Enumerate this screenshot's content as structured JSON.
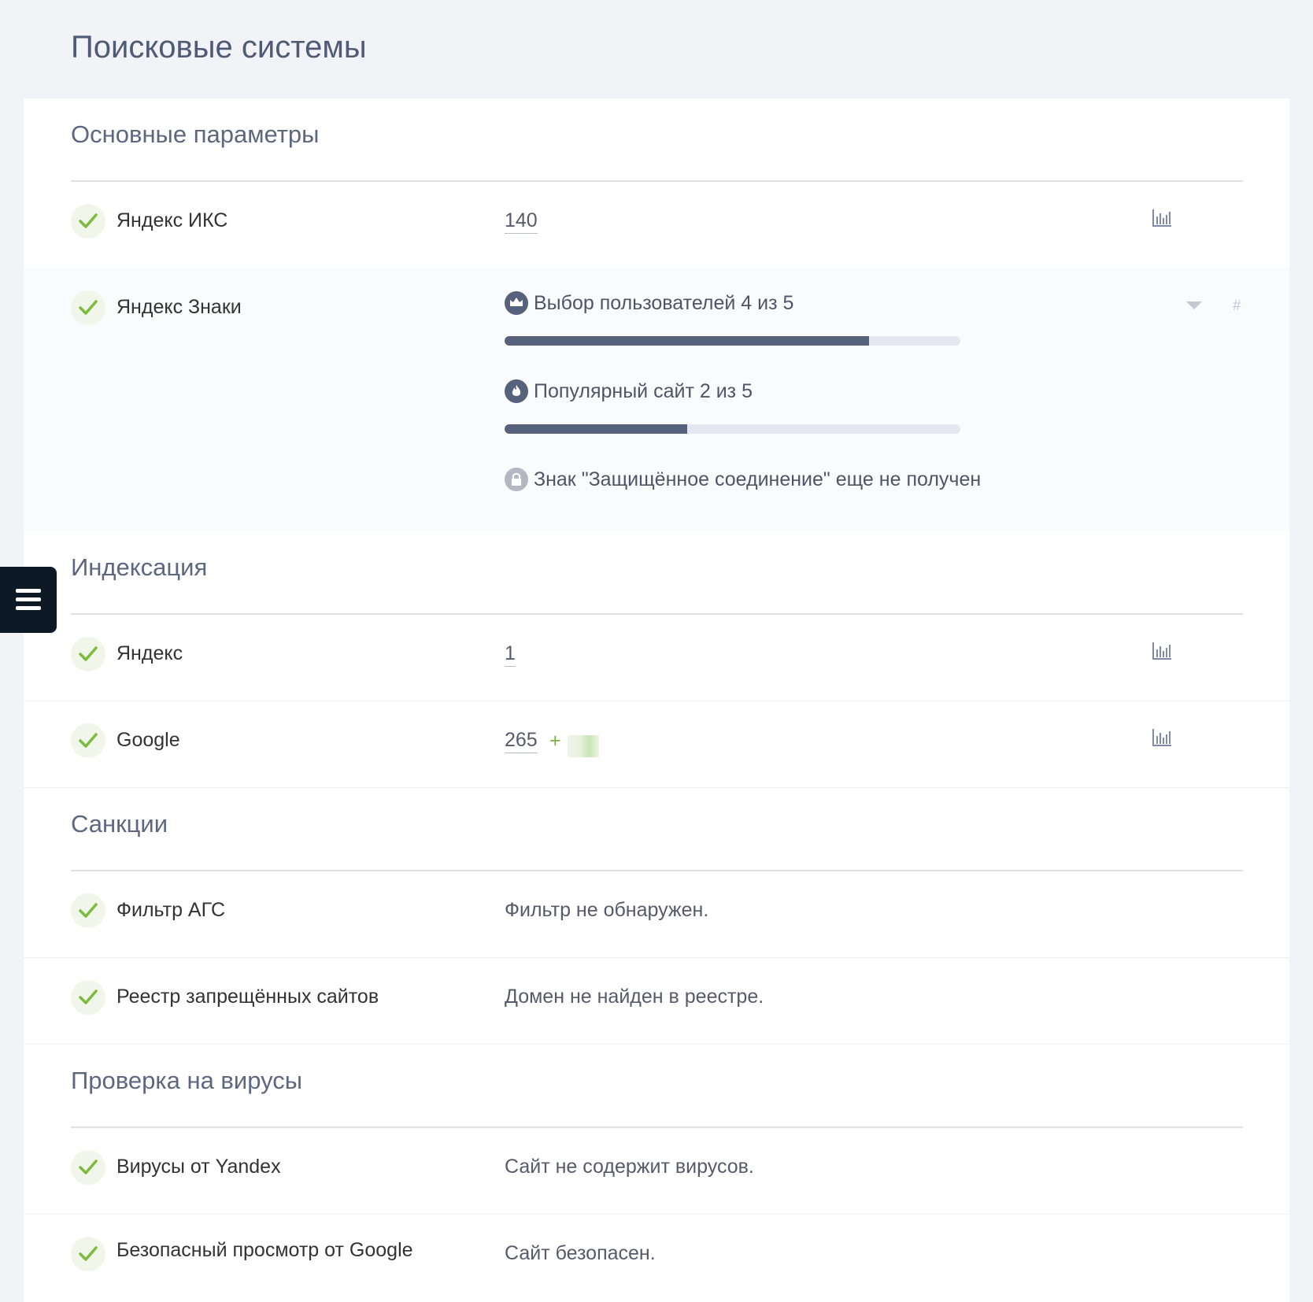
{
  "page_title": "Поисковые системы",
  "colors": {
    "accent": "#56627c",
    "check": "#7dbb3c",
    "menu_bg": "#0d1a26"
  },
  "sections": {
    "main": {
      "title": "Основные параметры",
      "iks": {
        "label": "Яндекс ИКС",
        "value": "140"
      },
      "znaki": {
        "label": "Яндекс Знаки",
        "badges": [
          {
            "icon": "crown-icon",
            "text": "Выбор пользователей 4 из 5",
            "progress": 0.8
          },
          {
            "icon": "fire-icon",
            "text": "Популярный сайт 2 из 5",
            "progress": 0.4
          },
          {
            "icon": "lock-icon",
            "text": "Знак \"Защищённое соединение\" еще не получен"
          }
        ],
        "hash": "#"
      }
    },
    "indexing": {
      "title": "Индексация",
      "yandex": {
        "label": "Яндекс",
        "value": "1"
      },
      "google": {
        "label": "Google",
        "value": "265",
        "delta_sign": "+"
      }
    },
    "sanctions": {
      "title": "Санкции",
      "ags": {
        "label": "Фильтр АГС",
        "value": "Фильтр не обнаружен."
      },
      "registry": {
        "label": "Реестр запрещённых сайтов",
        "value": "Домен не найден в реестре."
      }
    },
    "viruses": {
      "title": "Проверка на вирусы",
      "yandex": {
        "label": "Вирусы от Yandex",
        "value": "Сайт не содержит вирусов."
      },
      "google": {
        "label": "Безопасный просмотр от Google",
        "value": "Сайт безопасен."
      }
    }
  }
}
